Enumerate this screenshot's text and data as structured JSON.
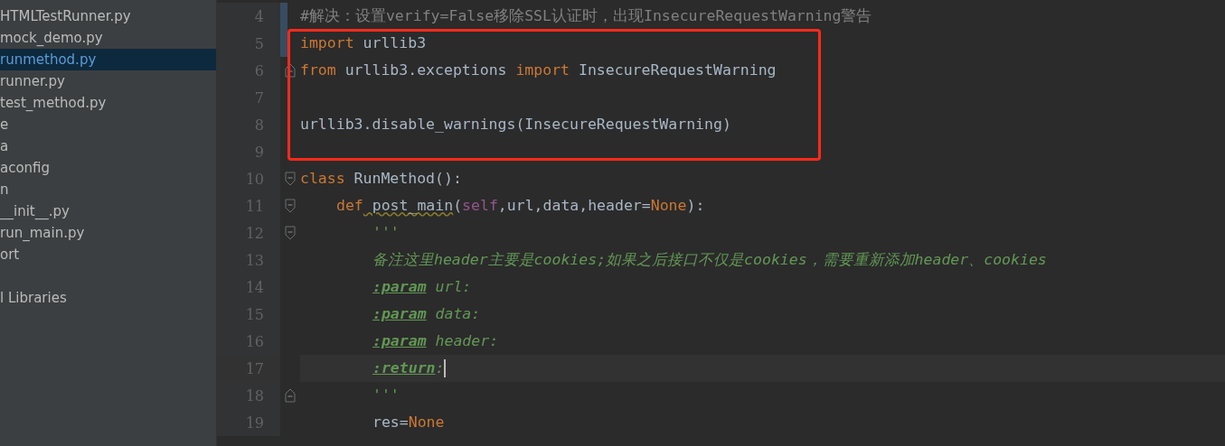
{
  "project_tree": {
    "items": [
      {
        "label": "HTMLTestRunner.py",
        "selected": false
      },
      {
        "label": "mock_demo.py",
        "selected": false
      },
      {
        "label": "runmethod.py",
        "selected": true
      },
      {
        "label": "runner.py",
        "selected": false
      },
      {
        "label": "test_method.py",
        "selected": false
      },
      {
        "label": "e",
        "selected": false
      },
      {
        "label": "a",
        "selected": false
      },
      {
        "label": "aconfig",
        "selected": false
      },
      {
        "label": "n",
        "selected": false
      },
      {
        "label": "__init__.py",
        "selected": false
      },
      {
        "label": "run_main.py",
        "selected": false
      },
      {
        "label": "ort",
        "selected": false
      },
      {
        "label": "l Libraries",
        "selected": false
      }
    ]
  },
  "editor": {
    "sections": [
      {
        "kind": "plain",
        "lines": [
          {
            "number": "4",
            "changed": true,
            "current": false,
            "tokens": [
              {
                "kind": "comment",
                "text": "#解决：设置verify=False移除SSL认证时，出现InsecureRequestWarning警告"
              }
            ]
          }
        ]
      },
      {
        "kind": "highlight_box",
        "lines": [
          {
            "number": "5",
            "changed": true,
            "current": false,
            "tokens": [
              {
                "kind": "keyword",
                "text": "import"
              },
              {
                "kind": "plain",
                "text": " urllib3"
              }
            ]
          },
          {
            "number": "6",
            "changed": false,
            "current": false,
            "fold": {
              "kind": "end"
            },
            "tokens": [
              {
                "kind": "keyword",
                "text": "from"
              },
              {
                "kind": "plain",
                "text": " urllib3.exceptions "
              },
              {
                "kind": "keyword",
                "text": "import"
              },
              {
                "kind": "plain",
                "text": " InsecureRequestWarning"
              }
            ]
          },
          {
            "number": "7",
            "changed": false,
            "current": false
          },
          {
            "number": "8",
            "changed": false,
            "current": false,
            "tokens": [
              {
                "kind": "plain",
                "text": "urllib3.disable_warnings(InsecureRequestWarning)"
              }
            ]
          },
          {
            "number": "9",
            "changed": false,
            "current": false
          }
        ]
      },
      {
        "kind": "plain",
        "lines": [
          {
            "number": "10",
            "changed": false,
            "current": false,
            "fold": {
              "kind": "start"
            },
            "tokens": [
              {
                "kind": "keyword",
                "text": "class"
              },
              {
                "kind": "plain",
                "text": " RunMethod():"
              }
            ],
            "children": [
              {
                "number": "11",
                "changed": false,
                "current": false,
                "fold": {
                  "kind": "start"
                },
                "tokens": [
                  {
                    "kind": "keyword",
                    "text": "def"
                  },
                  {
                    "kind": "funcname",
                    "text": " post_main"
                  },
                  {
                    "kind": "plain",
                    "text": "("
                  },
                  {
                    "kind": "self",
                    "text": "self"
                  },
                  {
                    "kind": "plain",
                    "text": ",url,data,header="
                  },
                  {
                    "kind": "keyword",
                    "text": "None"
                  },
                  {
                    "kind": "plain",
                    "text": "):"
                  }
                ],
                "children": [
                  {
                    "number": "12",
                    "changed": false,
                    "current": false,
                    "fold": {
                      "kind": "start"
                    },
                    "tokens": [
                      {
                        "kind": "doc",
                        "text": "'''"
                      }
                    ]
                  },
                  {
                    "number": "13",
                    "changed": false,
                    "current": false,
                    "tokens": [
                      {
                        "kind": "doc",
                        "text": "备注这里header主要是cookies;如果之后接口不仅是cookies，需要重新添加header、cookies"
                      }
                    ]
                  },
                  {
                    "number": "14",
                    "changed": false,
                    "current": false,
                    "tokens": [
                      {
                        "kind": "doctag",
                        "text": ":param"
                      },
                      {
                        "kind": "doc",
                        "text": " url:"
                      }
                    ]
                  },
                  {
                    "number": "15",
                    "changed": false,
                    "current": false,
                    "tokens": [
                      {
                        "kind": "doctag",
                        "text": ":param"
                      },
                      {
                        "kind": "doc",
                        "text": " data:"
                      }
                    ]
                  },
                  {
                    "number": "16",
                    "changed": false,
                    "current": false,
                    "tokens": [
                      {
                        "kind": "doctag",
                        "text": ":param"
                      },
                      {
                        "kind": "doc",
                        "text": " header:"
                      }
                    ]
                  },
                  {
                    "number": "17",
                    "changed": false,
                    "current": true,
                    "tokens": [
                      {
                        "kind": "doctag",
                        "text": ":return"
                      },
                      {
                        "kind": "doc",
                        "text": ":"
                      }
                    ]
                  },
                  {
                    "number": "18",
                    "changed": false,
                    "current": false,
                    "fold": {
                      "kind": "end"
                    },
                    "tokens": [
                      {
                        "kind": "doc",
                        "text": "'''"
                      }
                    ]
                  },
                  {
                    "number": "19",
                    "changed": false,
                    "current": false,
                    "tokens": [
                      {
                        "kind": "plain",
                        "text": "res="
                      },
                      {
                        "kind": "keyword",
                        "text": "None"
                      }
                    ]
                  }
                ]
              }
            ]
          }
        ]
      }
    ]
  }
}
